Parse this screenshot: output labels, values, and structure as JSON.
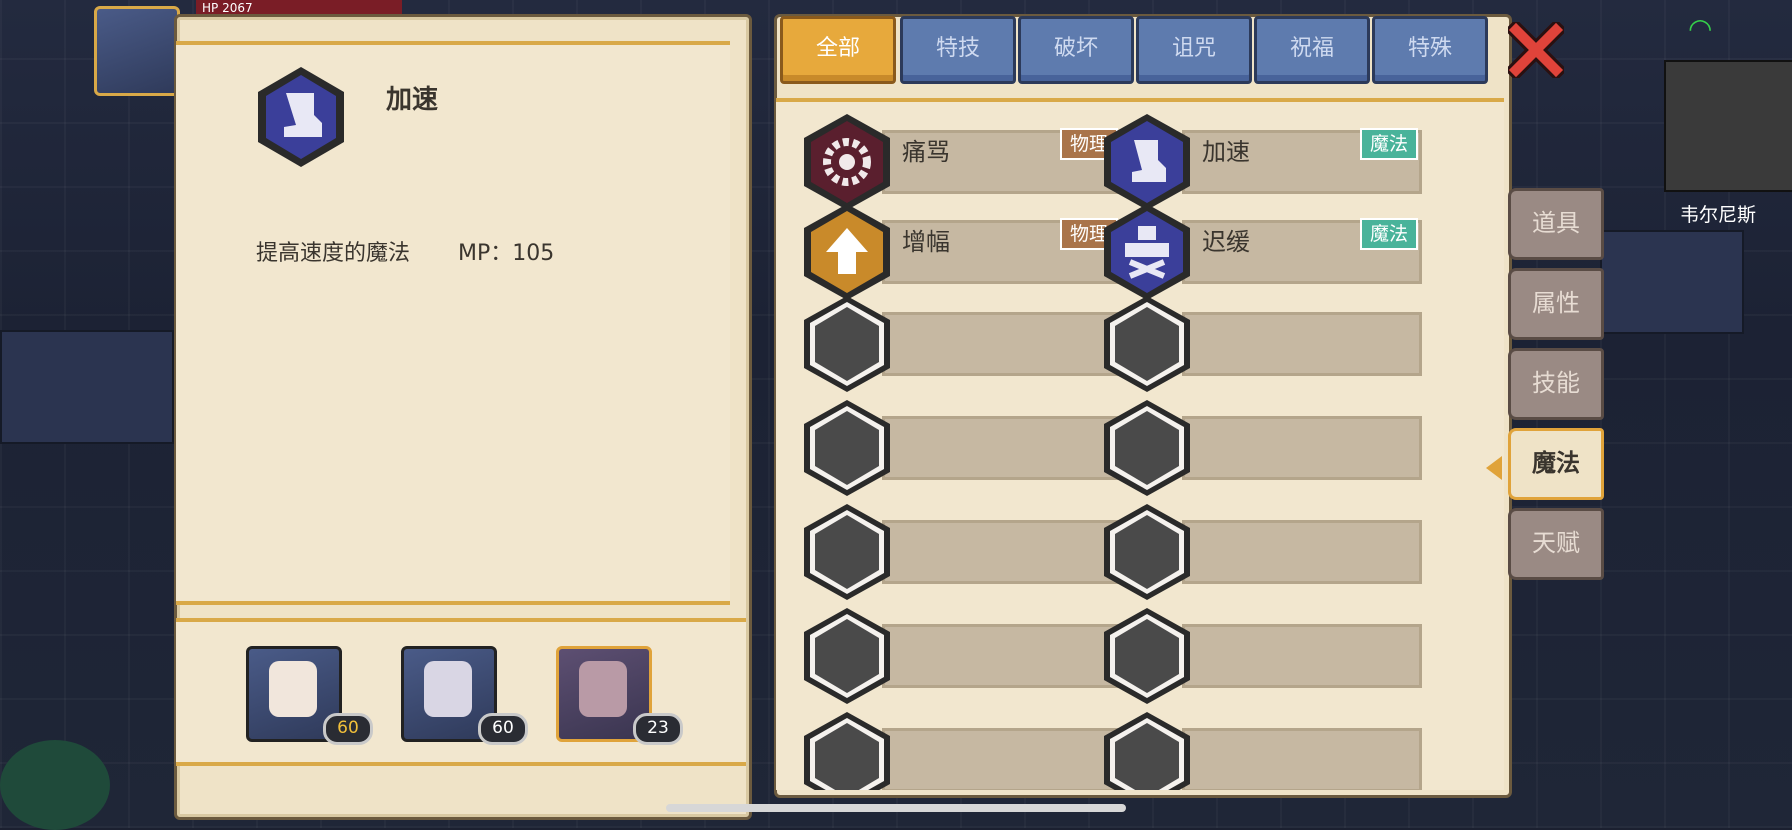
{
  "top_bar": {
    "hp_label": "HP 2067"
  },
  "npc": {
    "name": "韦尔尼斯"
  },
  "detail": {
    "name": "加速",
    "description": "提高速度的魔法",
    "mp": "MP：105"
  },
  "characters": [
    {
      "level": "60",
      "selected": false
    },
    {
      "level": "60",
      "selected": false
    },
    {
      "level": "23",
      "selected": true
    }
  ],
  "tabs": [
    "全部",
    "特技",
    "破坏",
    "诅咒",
    "祝福",
    "特殊"
  ],
  "active_tab": 0,
  "skills": [
    {
      "name": "痛骂",
      "type": "物理",
      "icon": "gear-icon",
      "color": "#5a1f2e"
    },
    {
      "name": "加速",
      "type": "魔法",
      "icon": "boot-icon",
      "color": "#3b3f9a"
    },
    {
      "name": "增幅",
      "type": "物理",
      "icon": "up-arrow-icon",
      "color": "#c98a2a"
    },
    {
      "name": "迟缓",
      "type": "魔法",
      "icon": "slow-icon",
      "color": "#3b3f9a"
    }
  ],
  "empty_slots": 10,
  "side_tabs": [
    "道具",
    "属性",
    "技能",
    "魔法",
    "天赋"
  ],
  "active_side_tab": 3,
  "colors": {
    "accent": "#e7a93c",
    "tab_blue": "#5e7bae",
    "physical": "#a9744a",
    "magic": "#49b39a"
  }
}
